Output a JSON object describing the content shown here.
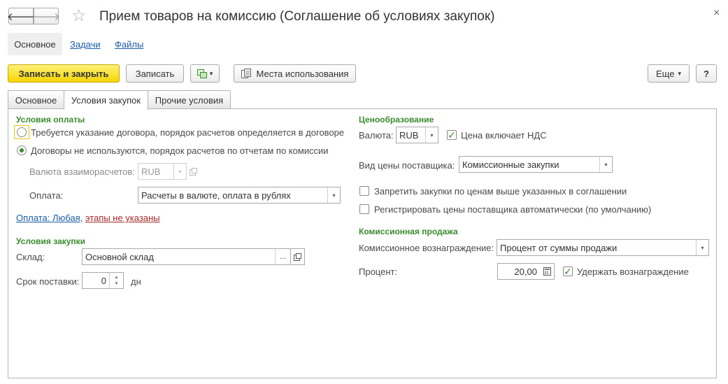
{
  "window": {
    "title": "Прием товаров на комиссию (Соглашение об условиях закупок)",
    "close_icon": "×"
  },
  "nav": {
    "back_icon": "🡐",
    "forward_icon": "🡒",
    "star_icon": "☆"
  },
  "topnav": {
    "items": [
      "Основное",
      "Задачи",
      "Файлы"
    ]
  },
  "toolbar": {
    "save_close_label": "Записать и закрыть",
    "save_label": "Записать",
    "usage_label": "Места использования",
    "more_label": "Еще",
    "help_label": "?",
    "dropdown_arrow": "▾"
  },
  "tabs": {
    "items": [
      "Основное",
      "Условия закупок",
      "Прочие условия"
    ],
    "active": 1
  },
  "payment": {
    "section_title": "Условия оплаты",
    "radio1_label": "Требуется указание договора, порядок расчетов определяется в договоре",
    "radio2_label": "Договоры не используются, порядок расчетов по отчетам по комиссии",
    "currency_label": "Валюта взаиморасчетов:",
    "currency_value": "RUB",
    "payment_label": "Оплата:",
    "payment_value": "Расчеты в валюте, оплата в рублях",
    "link_part1": "Оплата: Любая,",
    "link_part2": "этапы не указаны"
  },
  "purchase": {
    "section_title": "Условия закупки",
    "warehouse_label": "Склад:",
    "warehouse_value": "Основной склад",
    "ellipsis": "...",
    "term_label": "Срок поставки:",
    "term_value": "0",
    "term_unit": "дн"
  },
  "pricing": {
    "section_title": "Ценообразование",
    "currency_label": "Валюта:",
    "currency_value": "RUB",
    "vat_label": "Цена включает НДС",
    "supplier_price_label": "Вид цены поставщика:",
    "supplier_price_value": "Комиссионные закупки",
    "forbid_label": "Запретить закупки по ценам выше указанных в соглашении",
    "register_label": "Регистрировать цены поставщика автоматически (по умолчанию)"
  },
  "commission": {
    "section_title": "Комиссионная продажа",
    "reward_label": "Комиссионное вознаграждение:",
    "reward_value": "Процент от суммы продажи",
    "percent_label": "Процент:",
    "percent_value": "20,00",
    "withhold_label": "Удержать вознаграждение"
  },
  "colors": {
    "accent_green": "#3a8a2e",
    "primary_yellow": "#f5d500",
    "link_blue": "#1c5ba8",
    "link_red": "#a62a2a"
  }
}
